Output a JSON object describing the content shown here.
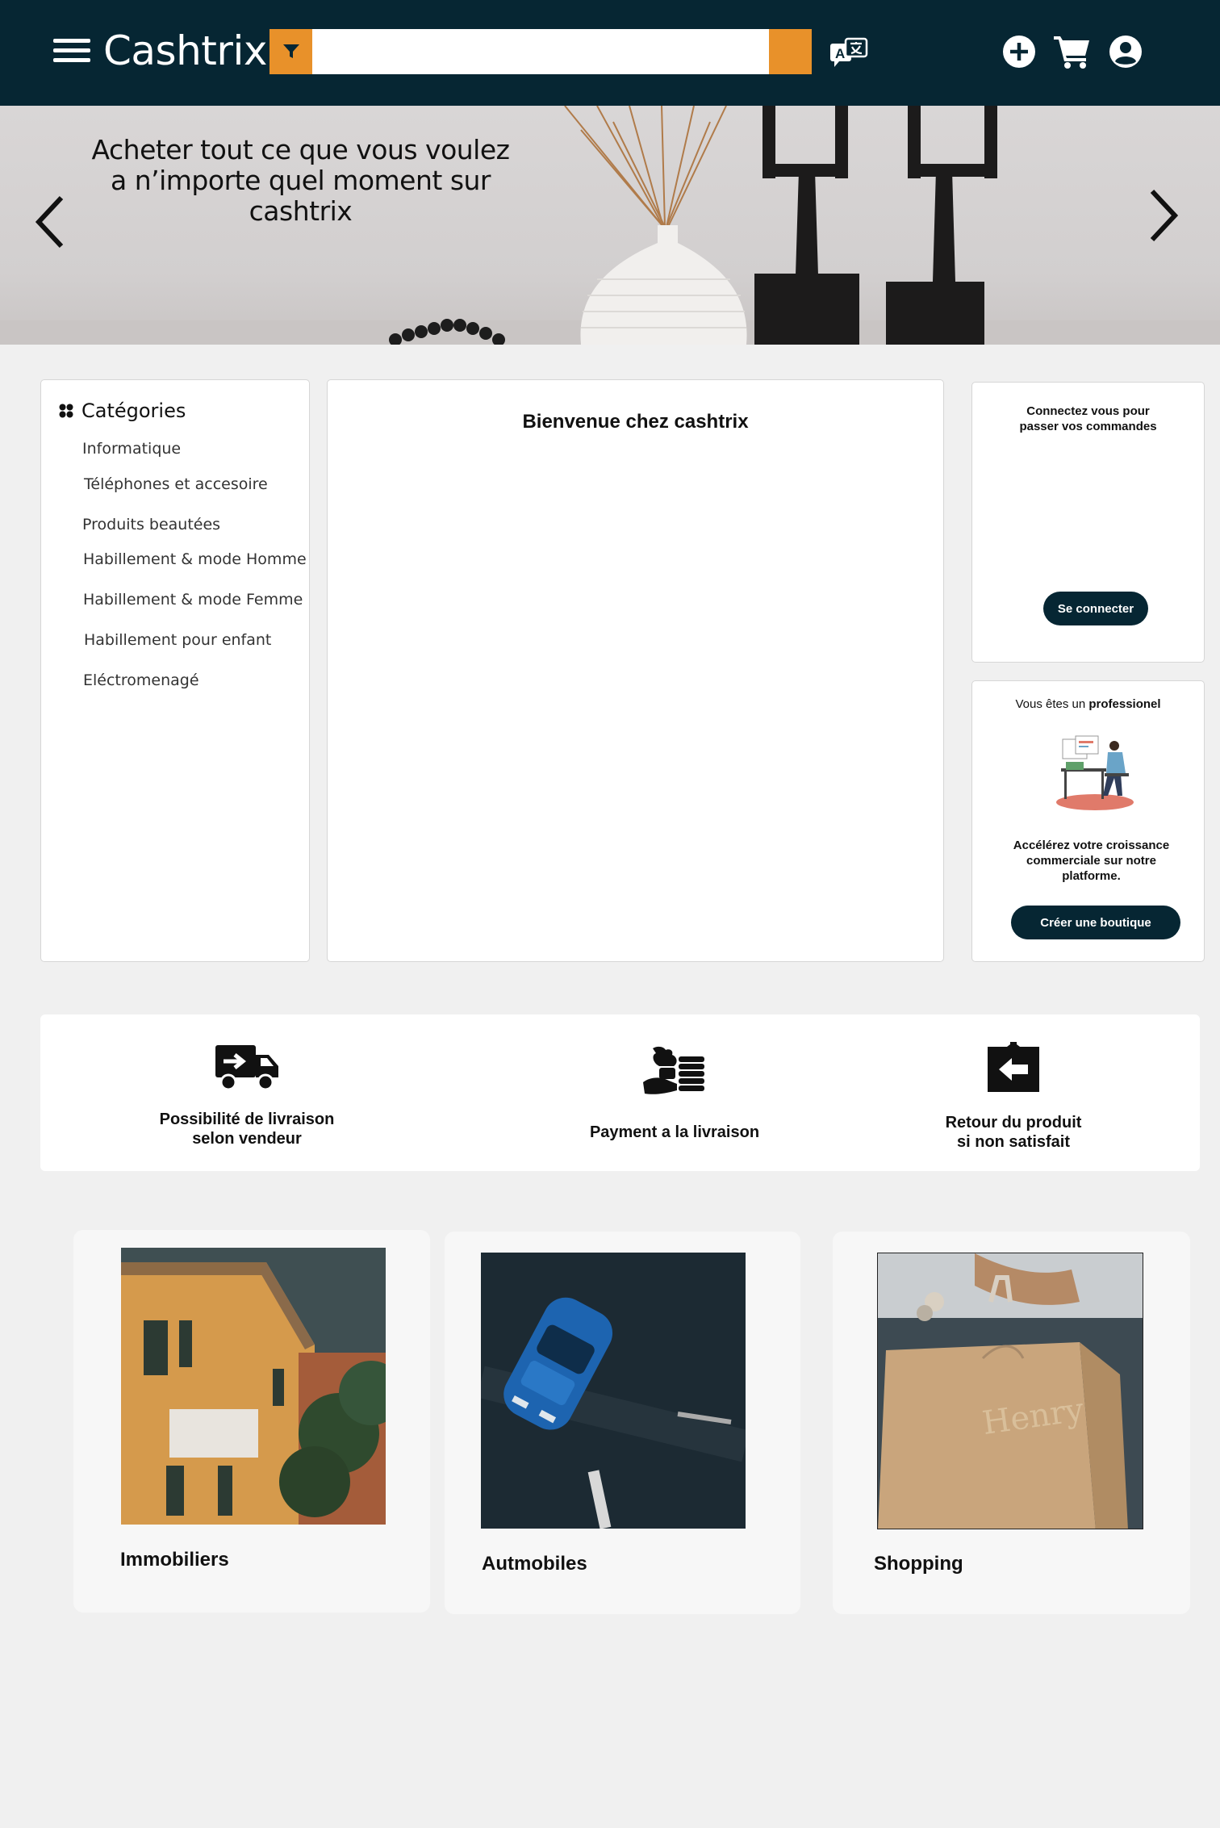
{
  "header": {
    "brand": "Cashtrix",
    "search": {
      "placeholder": "",
      "value": ""
    },
    "colors": {
      "background": "#062633",
      "accent": "#e8912a"
    },
    "icons": [
      "menu-icon",
      "filter-icon",
      "translate-icon",
      "add-icon",
      "cart-icon",
      "user-icon"
    ]
  },
  "hero": {
    "title": "Acheter tout ce que vous voulez a n’importe quel moment sur cashtrix"
  },
  "categories": {
    "title": "Catégories",
    "items": [
      "Informatique",
      "Téléphones et accesoire",
      "Produits beautées",
      "Habillement & mode Homme",
      "Habillement & mode Femme",
      "Habillement pour enfant",
      "Eléctromenagé"
    ]
  },
  "welcome": {
    "title": "Bienvenue chez cashtrix"
  },
  "login": {
    "text": "Connectez vous pour passer vos commandes",
    "button": "Se connecter"
  },
  "pro": {
    "text_prefix": "Vous êtes un",
    "text_bold": "professionel",
    "description": "Accélérez votre croissance commerciale sur notre platforme.",
    "button": "Créer une boutique"
  },
  "features": [
    {
      "icon": "delivery-truck-icon",
      "line1": "Possibilité de livraison",
      "line2": "selon vendeur"
    },
    {
      "icon": "payment-hand-coins-icon",
      "line1": "Payment a la livraison",
      "line2": ""
    },
    {
      "icon": "return-box-icon",
      "line1": "Retour du produit",
      "line2": "si non satisfait"
    }
  ],
  "cards": [
    {
      "label": "Immobiliers"
    },
    {
      "label": "Autmobiles"
    },
    {
      "label": "Shopping"
    }
  ]
}
